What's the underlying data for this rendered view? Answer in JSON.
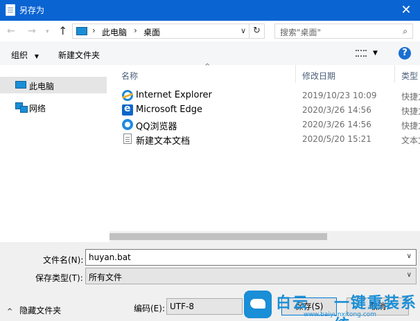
{
  "window": {
    "title": "另存为",
    "close_glyph": "✕"
  },
  "nav": {
    "back_glyph": "←",
    "forward_glyph": "→",
    "recent_glyph": "▾",
    "up_glyph": "↑",
    "address": {
      "crumbs": [
        "此电脑",
        "桌面"
      ],
      "separator": "›",
      "dropdown_glyph": "∨",
      "refresh_glyph": "↻"
    },
    "search": {
      "placeholder": "搜索\"桌面\"",
      "icon_glyph": "⌕"
    }
  },
  "toolbar": {
    "organize_label": "组织",
    "organize_caret": "▼",
    "new_folder_label": "新建文件夹",
    "view_caret": "▼",
    "help_label": "?"
  },
  "sidebar": {
    "items": [
      {
        "label": "此电脑",
        "icon": "computer-icon",
        "selected": true
      },
      {
        "label": "网络",
        "icon": "network-icon",
        "selected": false
      }
    ]
  },
  "files": {
    "columns": {
      "name": "名称",
      "date": "修改日期",
      "type": "类型",
      "sort_glyph": "^"
    },
    "rows": [
      {
        "name": "Internet Explorer",
        "date": "2019/10/23 10:09",
        "type": "快捷方式",
        "icon": "internet-explorer-icon"
      },
      {
        "name": "Microsoft Edge",
        "date": "2020/3/26 14:56",
        "type": "快捷方式",
        "icon": "microsoft-edge-icon"
      },
      {
        "name": "QQ浏览器",
        "date": "2020/3/26 14:56",
        "type": "快捷方式",
        "icon": "qq-browser-icon"
      },
      {
        "name": "新建文本文档",
        "date": "2020/5/20 15:21",
        "type": "文本文档",
        "icon": "text-document-icon"
      }
    ]
  },
  "form": {
    "filename_label": "文件名(N):",
    "filename_value": "huyan.bat",
    "savetype_label": "保存类型(T):",
    "savetype_value": "所有文件",
    "encoding_label": "编码(E):",
    "encoding_value": "UTF-8",
    "dropdown_glyph": "∨"
  },
  "footer": {
    "hide_folders_label": "隐藏文件夹",
    "hide_folders_caret": "^",
    "save_label": "保存(S)",
    "cancel_label": "取消"
  },
  "watermark": {
    "part1": "白云",
    "part2": "一键重装系统",
    "url": "www.baiyunxitong.com",
    "color": "#1a8ed6"
  },
  "colors": {
    "titlebar": "#0a64d2",
    "accent": "#0078d7",
    "selection": "#e5e5e5"
  }
}
